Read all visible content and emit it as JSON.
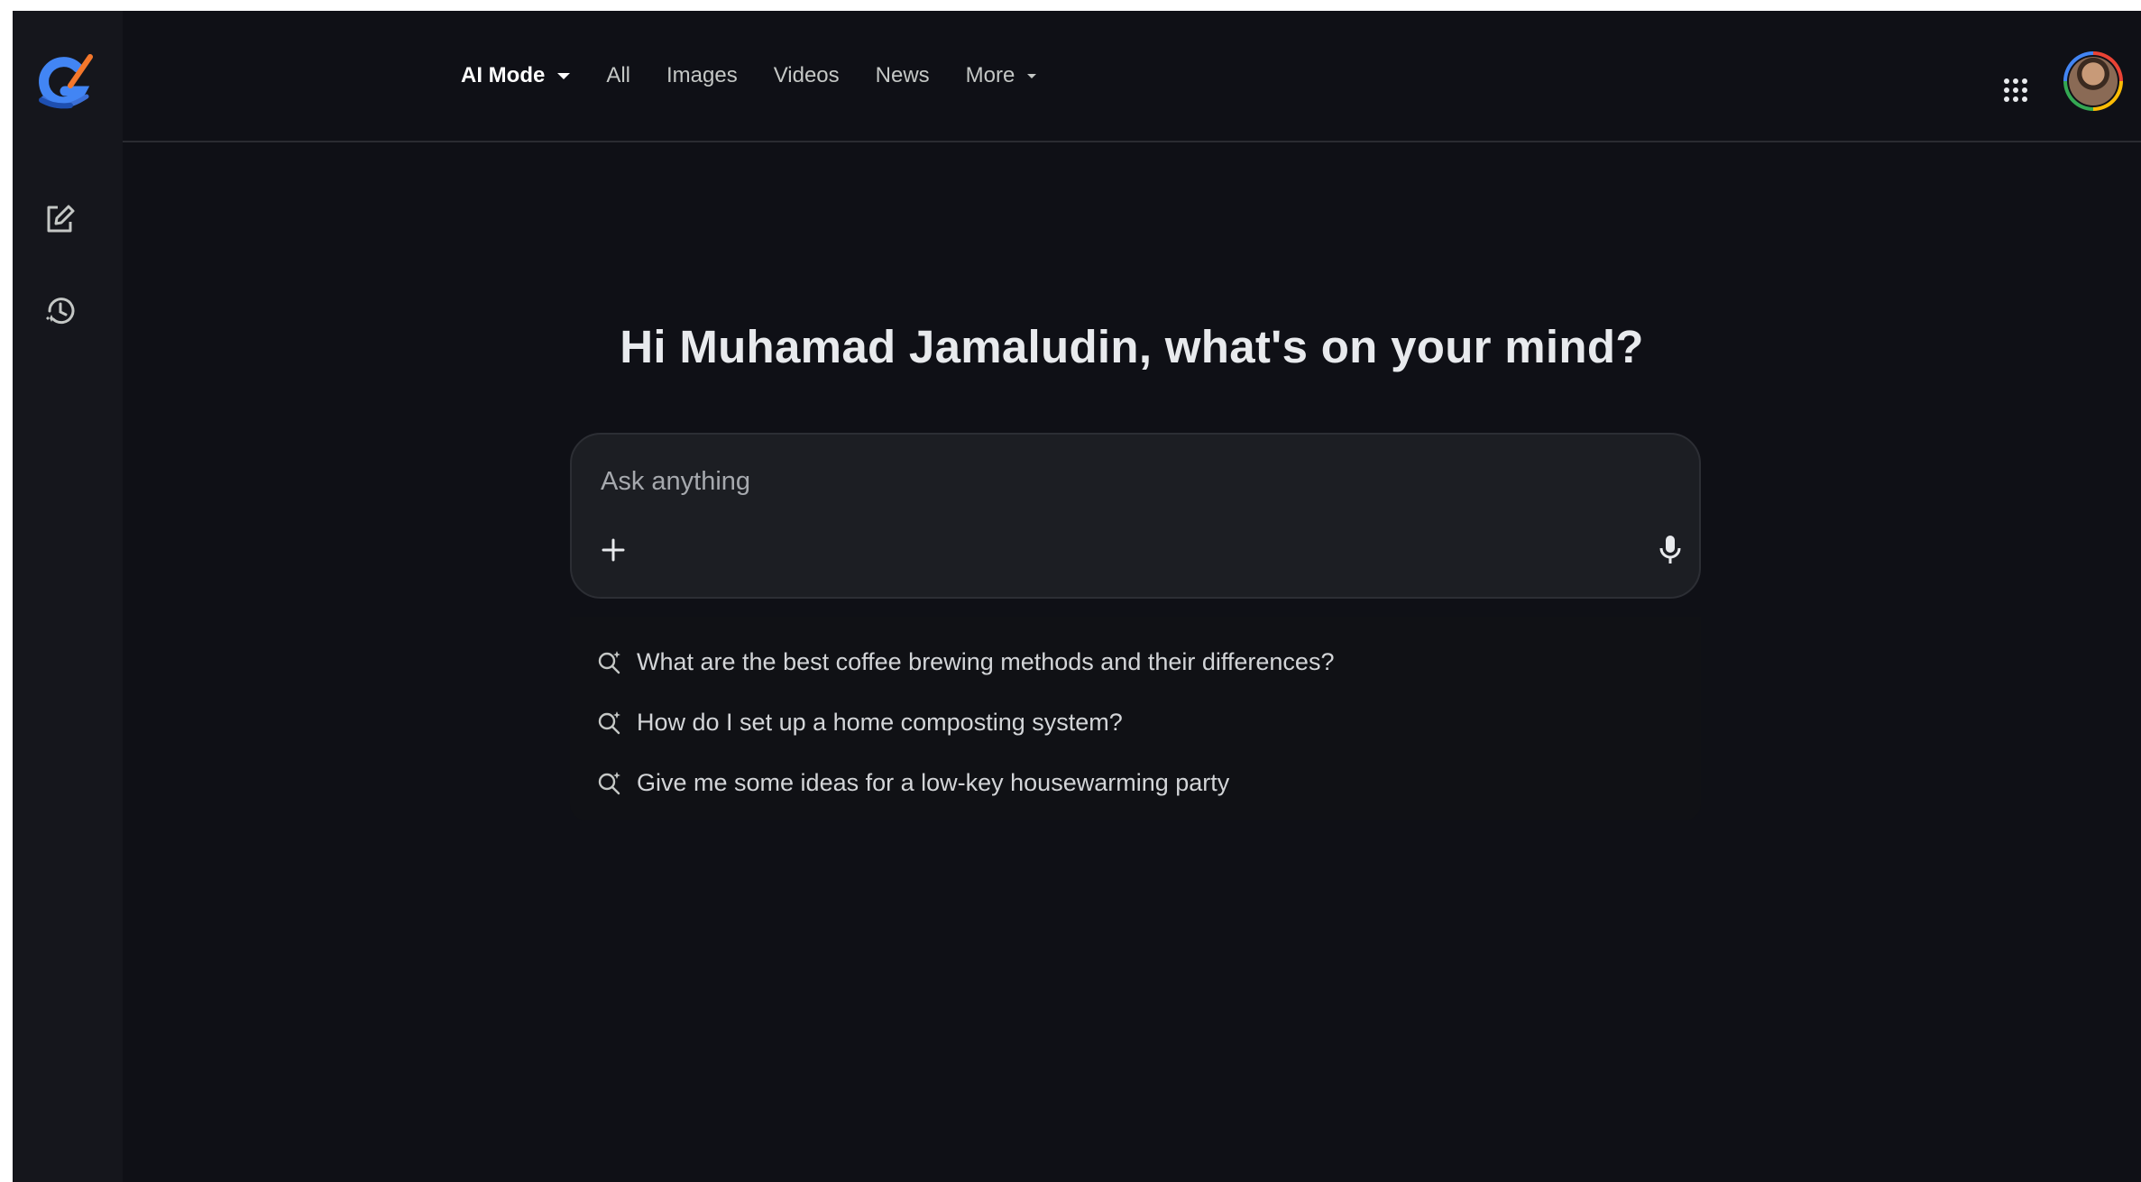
{
  "nav": {
    "tabs": [
      {
        "label": "AI Mode",
        "active": true,
        "has_dropdown": true
      },
      {
        "label": "All",
        "active": false,
        "has_dropdown": false
      },
      {
        "label": "Images",
        "active": false,
        "has_dropdown": false
      },
      {
        "label": "Videos",
        "active": false,
        "has_dropdown": false
      },
      {
        "label": "News",
        "active": false,
        "has_dropdown": false
      },
      {
        "label": "More",
        "active": false,
        "has_dropdown": true
      }
    ]
  },
  "sidebar": {
    "icons": [
      "google-logo-icon",
      "new-chat-icon",
      "history-icon"
    ]
  },
  "header_right": {
    "icons": [
      "apps-grid-icon",
      "account-avatar"
    ]
  },
  "main": {
    "greeting": "Hi Muhamad Jamaludin, what's on your mind?",
    "search": {
      "placeholder": "Ask anything",
      "value": ""
    },
    "suggestions": [
      {
        "text": "What are the best coffee brewing methods and their differences?"
      },
      {
        "text": "How do I set up a home composting system?"
      },
      {
        "text": "Give me some ideas for a low-key housewarming party"
      }
    ]
  },
  "colors": {
    "background": "#0f1016",
    "sidebar": "#15161c",
    "search_box": "#1c1e23",
    "text_primary": "#e8eaed",
    "text_secondary": "#c4c7c5"
  }
}
